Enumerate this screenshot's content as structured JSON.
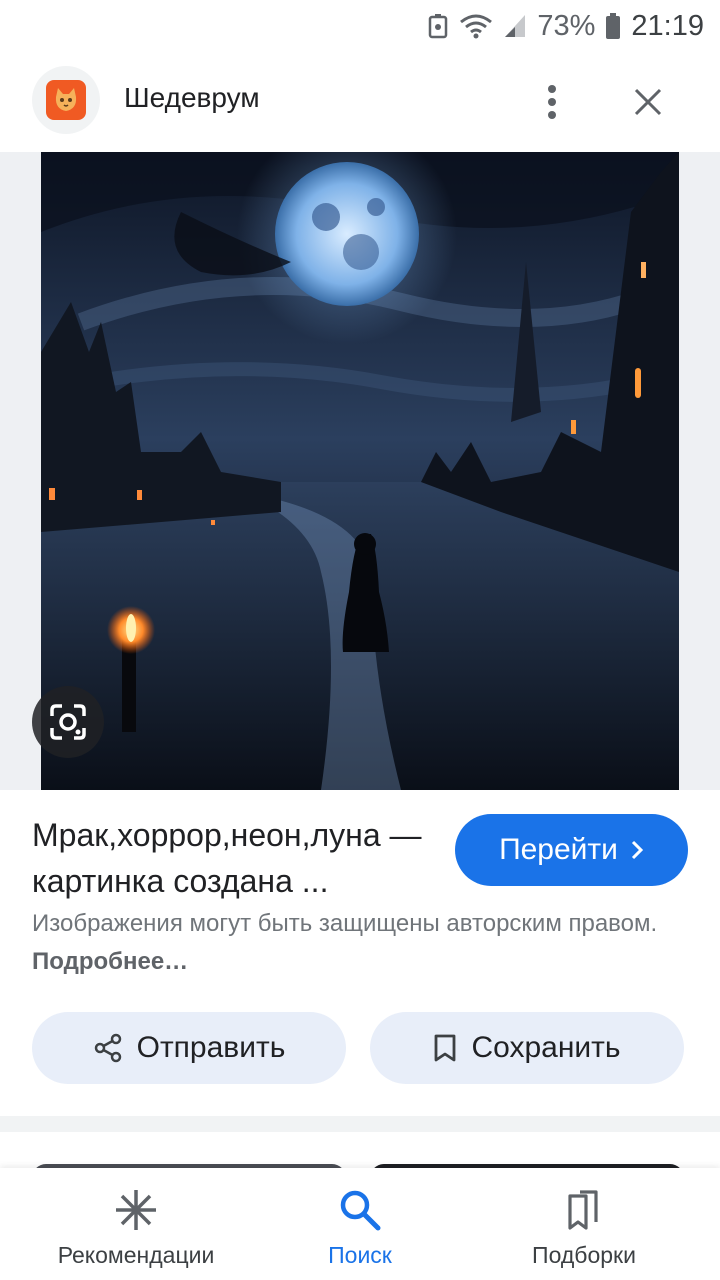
{
  "status_bar": {
    "battery": "73%",
    "time": "21:19"
  },
  "header": {
    "site_name": "Шедеврум"
  },
  "result": {
    "title": "Мрак,хоррор,неон,луна — картинка создана ...",
    "go_label": "Перейти",
    "copyright_text": "Изображения могут быть защищены авторским правом.",
    "more_link": "Подробнее…",
    "share_label": "Отправить",
    "save_label": "Сохранить"
  },
  "bottom_nav": {
    "items": [
      {
        "label": "Рекомендации",
        "icon": "asterisk-icon",
        "active": false
      },
      {
        "label": "Поиск",
        "icon": "search-icon",
        "active": true
      },
      {
        "label": "Подборки",
        "icon": "collections-icon",
        "active": false
      }
    ]
  },
  "colors": {
    "accent": "#1a73e8",
    "action_bg": "#e8eef9",
    "logo": "#f05a23"
  }
}
